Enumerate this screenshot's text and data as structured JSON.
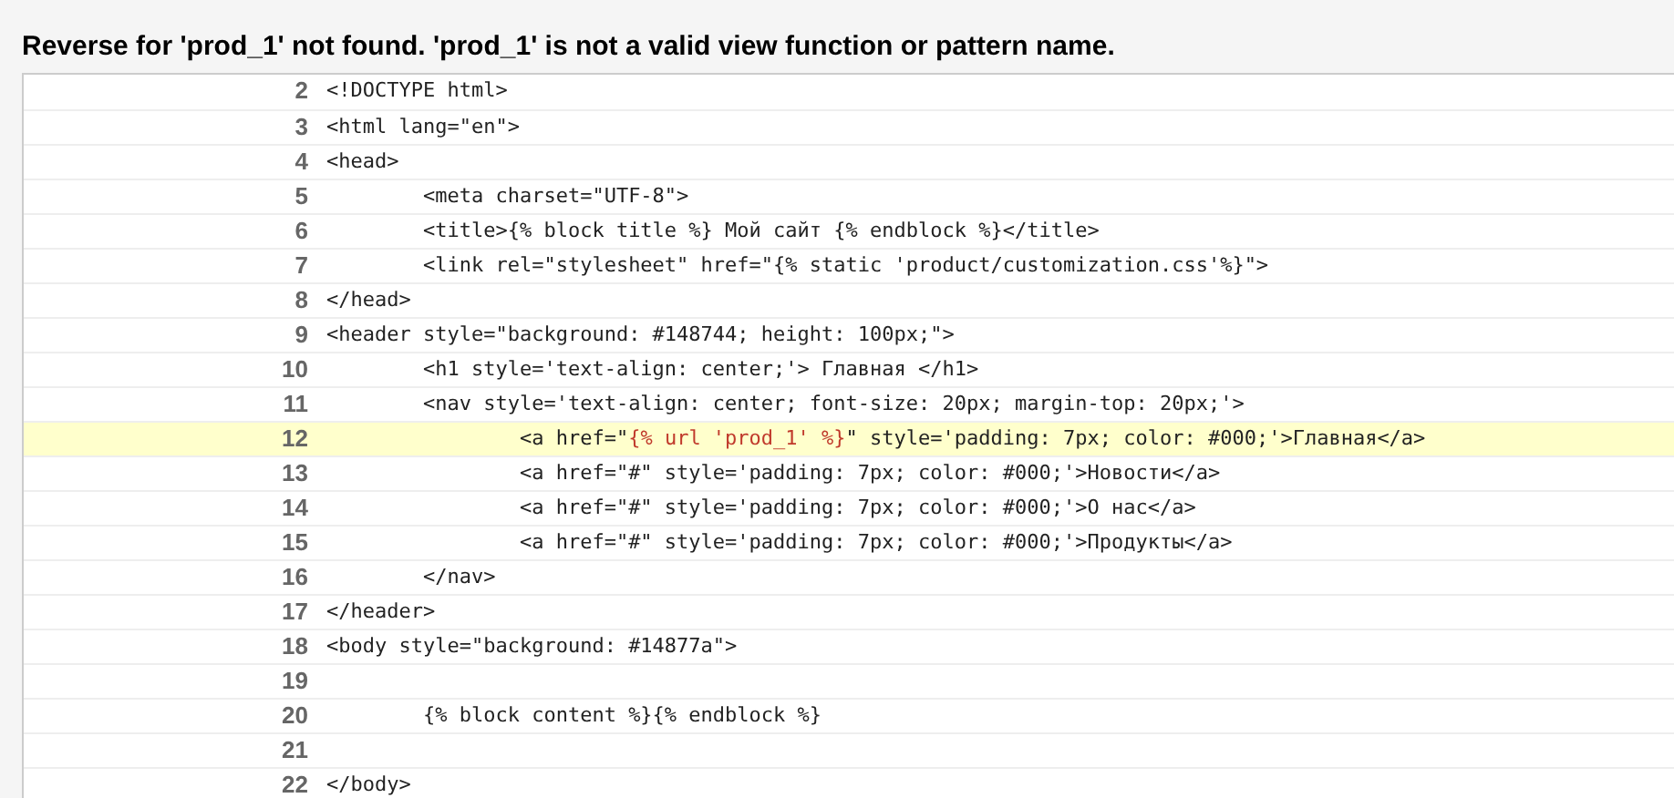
{
  "heading": "Reverse for 'prod_1' not found. 'prod_1' is not a valid view function or pattern name.",
  "lines": [
    {
      "number": "2",
      "code": "<!DOCTYPE html>",
      "selected": false
    },
    {
      "number": "3",
      "code": "<html lang=\"en\">",
      "selected": false
    },
    {
      "number": "4",
      "code": "<head>",
      "selected": false
    },
    {
      "number": "5",
      "code": "        <meta charset=\"UTF-8\">",
      "selected": false
    },
    {
      "number": "6",
      "code": "        <title>{% block title %} Мой сайт {% endblock %}</title>",
      "selected": false
    },
    {
      "number": "7",
      "code": "        <link rel=\"stylesheet\" href=\"{% static 'product/customization.css'%}\">",
      "selected": false
    },
    {
      "number": "8",
      "code": "</head>",
      "selected": false
    },
    {
      "number": "9",
      "code": "<header style=\"background: #148744; height: 100px;\">",
      "selected": false
    },
    {
      "number": "10",
      "code": "        <h1 style='text-align: center;'> Главная </h1>",
      "selected": false
    },
    {
      "number": "11",
      "code": "        <nav style='text-align: center; font-size: 20px; margin-top: 20px;'>",
      "selected": false
    },
    {
      "number": "12",
      "code": "                <a href=\"",
      "error_token": "{% url 'prod_1' %}",
      "code_after": "\" style='padding: 7px; color: #000;'>Главная</a>",
      "selected": true
    },
    {
      "number": "13",
      "code": "                <a href=\"#\" style='padding: 7px; color: #000;'>Новости</a>",
      "selected": false
    },
    {
      "number": "14",
      "code": "                <a href=\"#\" style='padding: 7px; color: #000;'>О нас</a>",
      "selected": false
    },
    {
      "number": "15",
      "code": "                <a href=\"#\" style='padding: 7px; color: #000;'>Продукты</a>",
      "selected": false
    },
    {
      "number": "16",
      "code": "        </nav>",
      "selected": false
    },
    {
      "number": "17",
      "code": "</header>",
      "selected": false
    },
    {
      "number": "18",
      "code": "<body style=\"background: #14877a\">",
      "selected": false
    },
    {
      "number": "19",
      "selected": false
    },
    {
      "number": "20",
      "code": "        {% block content %}{% endblock %}",
      "selected": false
    },
    {
      "number": "21",
      "selected": false
    },
    {
      "number": "22",
      "code": "</body>",
      "selected": false
    }
  ]
}
